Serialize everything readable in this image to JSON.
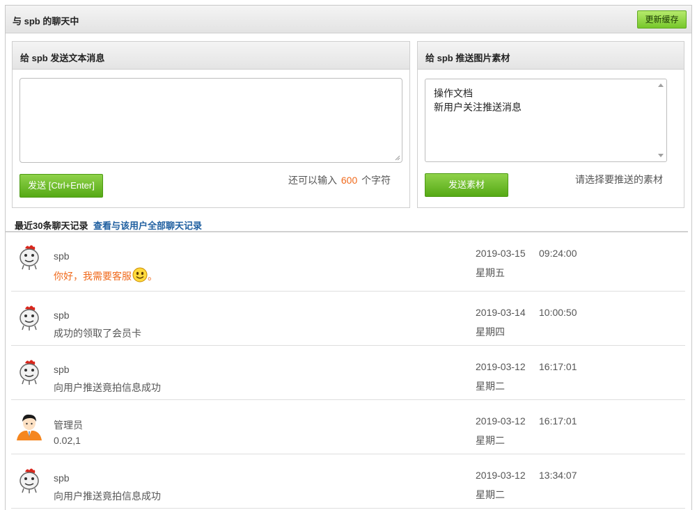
{
  "header": {
    "title": "与 spb 的聊天中",
    "refresh_label": "更新缓存"
  },
  "text_panel": {
    "title": "给 spb 发送文本消息",
    "textarea_value": "",
    "send_label": "发送 [Ctrl+Enter]",
    "remain_prefix": "还可以输入",
    "remain_count": "600",
    "remain_suffix": "个字符"
  },
  "image_panel": {
    "title": "给 spb 推送图片素材",
    "options": [
      "操作文档",
      "新用户关注推送消息"
    ],
    "send_label": "发送素材",
    "hint": "请选择要推送的素材"
  },
  "tabs": {
    "recent": "最近30条聊天记录",
    "all": "查看与该用户全部聊天记录"
  },
  "messages": [
    {
      "name": "spb",
      "text": "你好，我需要客服",
      "text_tail": "。",
      "date": "2019-03-15",
      "time": "09:24:00",
      "weekday": "星期五",
      "avatar": "chicken-avatar-icon",
      "highlight": true,
      "emoji": "smiley-icon"
    },
    {
      "name": "spb",
      "text": "成功的领取了会员卡",
      "date": "2019-03-14",
      "time": "10:00:50",
      "weekday": "星期四",
      "avatar": "chicken-avatar-icon"
    },
    {
      "name": "spb",
      "text": "向用户推送竟拍信息成功",
      "date": "2019-03-12",
      "time": "16:17:01",
      "weekday": "星期二",
      "avatar": "chicken-avatar-icon"
    },
    {
      "name": "管理员",
      "text": "0.02,1",
      "date": "2019-03-12",
      "time": "16:17:01",
      "weekday": "星期二",
      "avatar": "admin-avatar-icon"
    },
    {
      "name": "spb",
      "text": "向用户推送竟拍信息成功",
      "date": "2019-03-12",
      "time": "13:34:07",
      "weekday": "星期二",
      "avatar": "chicken-avatar-icon"
    }
  ],
  "colors": {
    "accent_green": "#55a915",
    "link_blue": "#1f5fa0",
    "highlight_orange": "#f06a1c"
  }
}
